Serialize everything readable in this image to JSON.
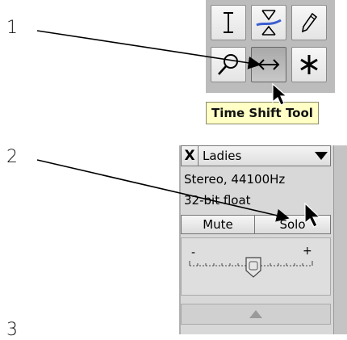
{
  "steps": {
    "one": "1",
    "two": "2",
    "three": "3"
  },
  "tooltip": {
    "text": "Time Shift Tool"
  },
  "toolbar": {
    "tools": [
      {
        "name": "selection-tool",
        "icon": "i-beam-icon",
        "active": false
      },
      {
        "name": "envelope-tool",
        "icon": "envelope-icon",
        "active": false
      },
      {
        "name": "draw-tool",
        "icon": "pencil-icon",
        "active": false
      },
      {
        "name": "zoom-tool",
        "icon": "magnifier-icon",
        "active": false
      },
      {
        "name": "time-shift-tool",
        "icon": "double-arrow-icon",
        "active": true
      },
      {
        "name": "multi-tool",
        "icon": "asterisk-icon",
        "active": false
      }
    ]
  },
  "track": {
    "close": "X",
    "name": "Ladies",
    "format": "Stereo, 44100Hz",
    "bitdepth": "32-bit float",
    "mute_label": "Mute",
    "solo_label": "Solo",
    "gain_minus": "-",
    "gain_plus": "+"
  },
  "colors": {
    "tooltip_bg": "#ffffc6",
    "envelope_blue": "#3a5fd0"
  }
}
